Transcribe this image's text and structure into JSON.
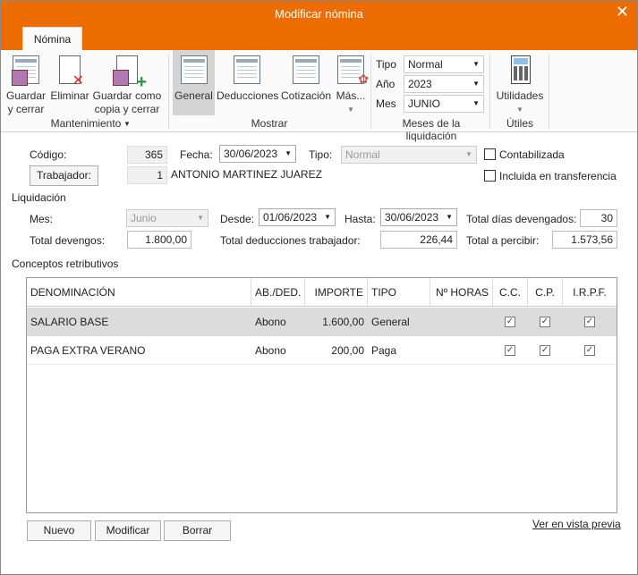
{
  "window": {
    "title": "Modificar nómina",
    "close_icon": "close-icon",
    "accent": "#ec6c00"
  },
  "ribbon": {
    "tab": "Nómina",
    "mantenimiento": {
      "label": "Mantenimiento",
      "guardar_line1": "Guardar",
      "guardar_line2": "y cerrar",
      "eliminar": "Eliminar",
      "copia_line1": "Guardar como",
      "copia_line2": "copia y cerrar"
    },
    "mostrar": {
      "label": "Mostrar",
      "general": "General",
      "deducciones": "Deducciones",
      "cotizacion": "Cotización",
      "mas": "Más..."
    },
    "meses": {
      "label": "Meses de la liquidación",
      "tipo_label": "Tipo",
      "tipo_value": "Normal",
      "anio_label": "Año",
      "anio_value": "2023",
      "mes_label": "Mes",
      "mes_value": "JUNIO"
    },
    "utiles": {
      "label": "Útiles",
      "utilidades": "Utilidades"
    }
  },
  "form": {
    "codigo_label": "Código:",
    "codigo_value": "365",
    "fecha_label": "Fecha:",
    "fecha_value": "30/06/2023",
    "tipo_label": "Tipo:",
    "tipo_value": "Normal",
    "contabilizada_label": "Contabilizada",
    "contabilizada_checked": false,
    "trabajador_button": "Trabajador:",
    "trabajador_id": "1",
    "trabajador_name": "ANTONIO MARTINEZ JUAREZ",
    "transferencia_label": "Incluida en transferencia",
    "transferencia_checked": false,
    "liquidacion_title": "Liquidación",
    "mes_label": "Mes:",
    "mes_value": "Junio",
    "desde_label": "Desde:",
    "desde_value": "01/06/2023",
    "hasta_label": "Hasta:",
    "hasta_value": "30/06/2023",
    "dias_label": "Total días devengados:",
    "dias_value": "30",
    "devengos_label": "Total devengos:",
    "devengos_value": "1.800,00",
    "deducciones_label": "Total deducciones trabajador:",
    "deducciones_value": "226,44",
    "percibir_label": "Total a percibir:",
    "percibir_value": "1.573,56",
    "conceptos_title": "Conceptos retributivos"
  },
  "table": {
    "headers": [
      "DENOMINACIÓN",
      "AB./DED.",
      "IMPORTE",
      "TIPO",
      "Nº HORAS",
      "C.C.",
      "C.P.",
      "I.R.P.F."
    ],
    "rows": [
      {
        "denominacion": "SALARIO BASE",
        "abded": "Abono",
        "importe": "1.600,00",
        "tipo": "General",
        "horas": "",
        "cc": true,
        "cp": true,
        "irpf": true
      },
      {
        "denominacion": "PAGA EXTRA VERANO",
        "abded": "Abono",
        "importe": "200,00",
        "tipo": "Paga",
        "horas": "",
        "cc": true,
        "cp": true,
        "irpf": true
      }
    ]
  },
  "footer": {
    "nuevo": "Nuevo",
    "modificar": "Modificar",
    "borrar": "Borrar",
    "vista_previa": "Ver en vista previa"
  }
}
